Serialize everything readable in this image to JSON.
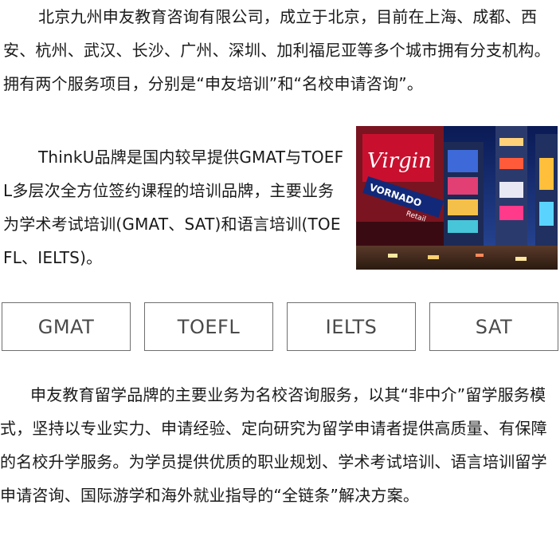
{
  "intro": {
    "text": "北京九州申友教育咨询有限公司，成立于北京，目前在上海、成都、西安、杭州、武汉、长沙、广州、深圳、加利福尼亚等多个城市拥有分支机构。拥有两个服务项目，分别是“申友培训”和“名校申请咨询”。"
  },
  "thinku": {
    "text": "ThinkU品牌是国内较早提供GMAT与TOEFL多层次全方位签约课程的培训品牌，主要业务为学术考试培训(GMAT、SAT)和语言培训(TOEFL、IELTS)。"
  },
  "photo": {
    "sign_virgin": "Virgin",
    "sign_vornado": "VORNADO",
    "sign_retail": "Retail"
  },
  "tags": [
    {
      "label": "GMAT"
    },
    {
      "label": "TOEFL"
    },
    {
      "label": "IELTS"
    },
    {
      "label": "SAT"
    }
  ],
  "shenyou": {
    "text": "申友教育留学品牌的主要业务为名校咨询服务，以其“非中介”留学服务模式，坚持以专业实力、申请经验、定向研究为留学申请者提供高质量、有保障的名校升学服务。为学员提供优质的职业规划、学术考试培训、语言培训留学申请咨询、国际游学和海外就业指导的“全链条”解决方案。"
  },
  "colors": {
    "text": "#1a1a1a",
    "tag_border": "#6f6f6f",
    "tag_text": "#4a4a4a"
  }
}
